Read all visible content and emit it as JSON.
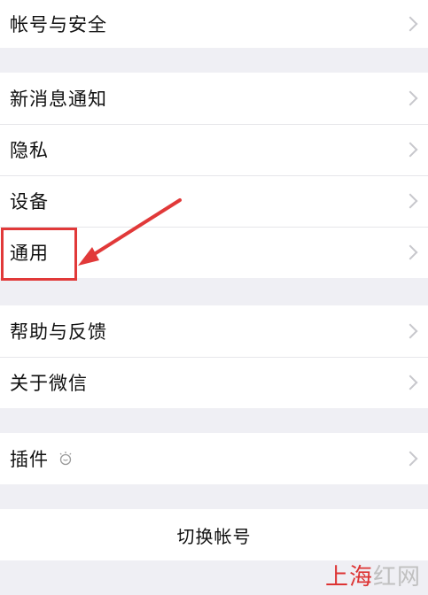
{
  "settings": {
    "group1": [
      {
        "label": "帐号与安全"
      }
    ],
    "group2": [
      {
        "label": "新消息通知"
      },
      {
        "label": "隐私"
      },
      {
        "label": "设备"
      },
      {
        "label": "通用"
      }
    ],
    "group3": [
      {
        "label": "帮助与反馈"
      },
      {
        "label": "关于微信"
      }
    ],
    "group4": [
      {
        "label": "插件",
        "icon": "plugin-bulb-icon"
      }
    ],
    "switch_account": "切换帐号"
  },
  "annotation": {
    "highlight_color": "#e13939"
  },
  "watermark": {
    "text_red": "上海",
    "text_gray": "红网"
  }
}
